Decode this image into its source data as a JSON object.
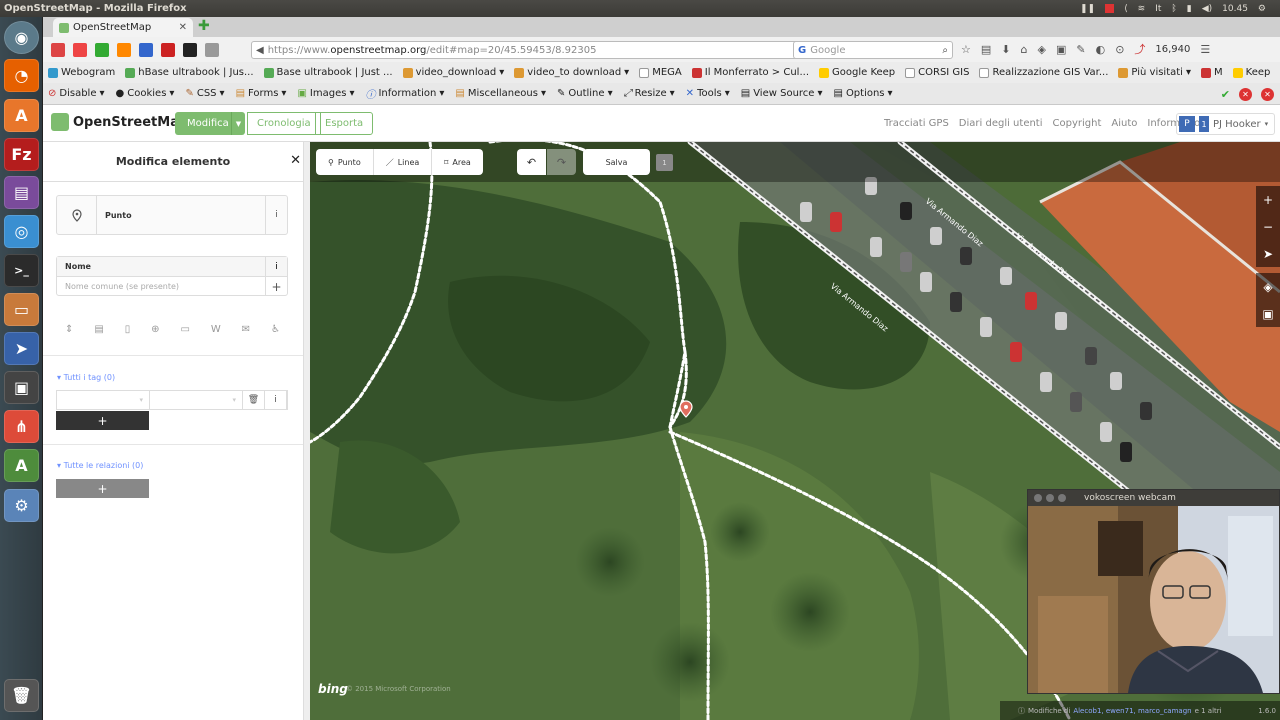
{
  "system": {
    "window_title": "OpenStreetMap - Mozilla Firefox",
    "clock": "10.45",
    "tray_icons": [
      "pause-icon",
      "record-icon",
      "share-icon",
      "wifi-icon",
      "keyboard-layout-icon",
      "bluetooth-icon",
      "battery-icon",
      "volume-icon"
    ]
  },
  "launcher": {
    "items": [
      "dash-icon",
      "firefox-icon",
      "software-center-icon",
      "filezilla-icon",
      "app-icon",
      "chrome-icon",
      "terminal-icon",
      "files-icon",
      "screenshot-icon",
      "monitor-icon",
      "share-app-icon",
      "updater-icon",
      "settings-icon",
      "trash-icon"
    ]
  },
  "browser": {
    "tab_title": "OpenStreetMap",
    "url_prefix": "https://www.",
    "url_host": "openstreetmap.org",
    "url_path": "/edit#map=20/45.59453/8.92305",
    "search_placeholder": "Google",
    "counter": "16,940",
    "bookmarks": [
      "Webogram",
      "hBase ultrabook | Jus...",
      "Base ultrabook | Just ...",
      "video_download",
      "video_to download",
      "MEGA",
      "Il Monferrato > Cul...",
      "Google Keep",
      "CORSI GIS",
      "Realizzazione GIS Var...",
      "Più visitati",
      "M",
      "Keep",
      "#"
    ],
    "devbar": [
      "Disable",
      "Cookies",
      "CSS",
      "Forms",
      "Images",
      "Information",
      "Miscellaneous",
      "Outline",
      "Resize",
      "Tools",
      "View Source",
      "Options"
    ]
  },
  "osm": {
    "brand": "OpenStreetMap",
    "nav": {
      "edit": "Modifica",
      "history": "Cronologia",
      "export": "Esporta"
    },
    "links": [
      "Tracciati GPS",
      "Diari degli utenti",
      "Copyright",
      "Aiuto",
      "Informazioni"
    ],
    "user": "PJ Hooker",
    "user_badge": "1"
  },
  "sidebar": {
    "title": "Modifica elemento",
    "preset_label": "Punto",
    "name_label": "Nome",
    "name_placeholder": "Nome comune (se presente)",
    "tags_toggle": "Tutti i tag (0)",
    "relations_toggle": "Tutte le relazioni (0)",
    "add_symbol": "+"
  },
  "map": {
    "tools": {
      "point": "Punto",
      "line": "Linea",
      "area": "Area"
    },
    "save": "Salva",
    "save_count": "1",
    "street_name": "Via Armando Diaz",
    "bing": "bing",
    "imagery_credit": "© 2015 Microsoft Corporation",
    "footer_text": "Modifiche di",
    "footer_users": "Alecob1, ewen71, marco_camagn",
    "footer_more": "e 1 altri",
    "version": "1.6.0"
  },
  "webcam": {
    "title": "vokoscreen webcam"
  },
  "colors": {
    "osm_green": "#7ebc6f",
    "link_blue": "#7092ff",
    "pin_red": "#e06e5f"
  }
}
